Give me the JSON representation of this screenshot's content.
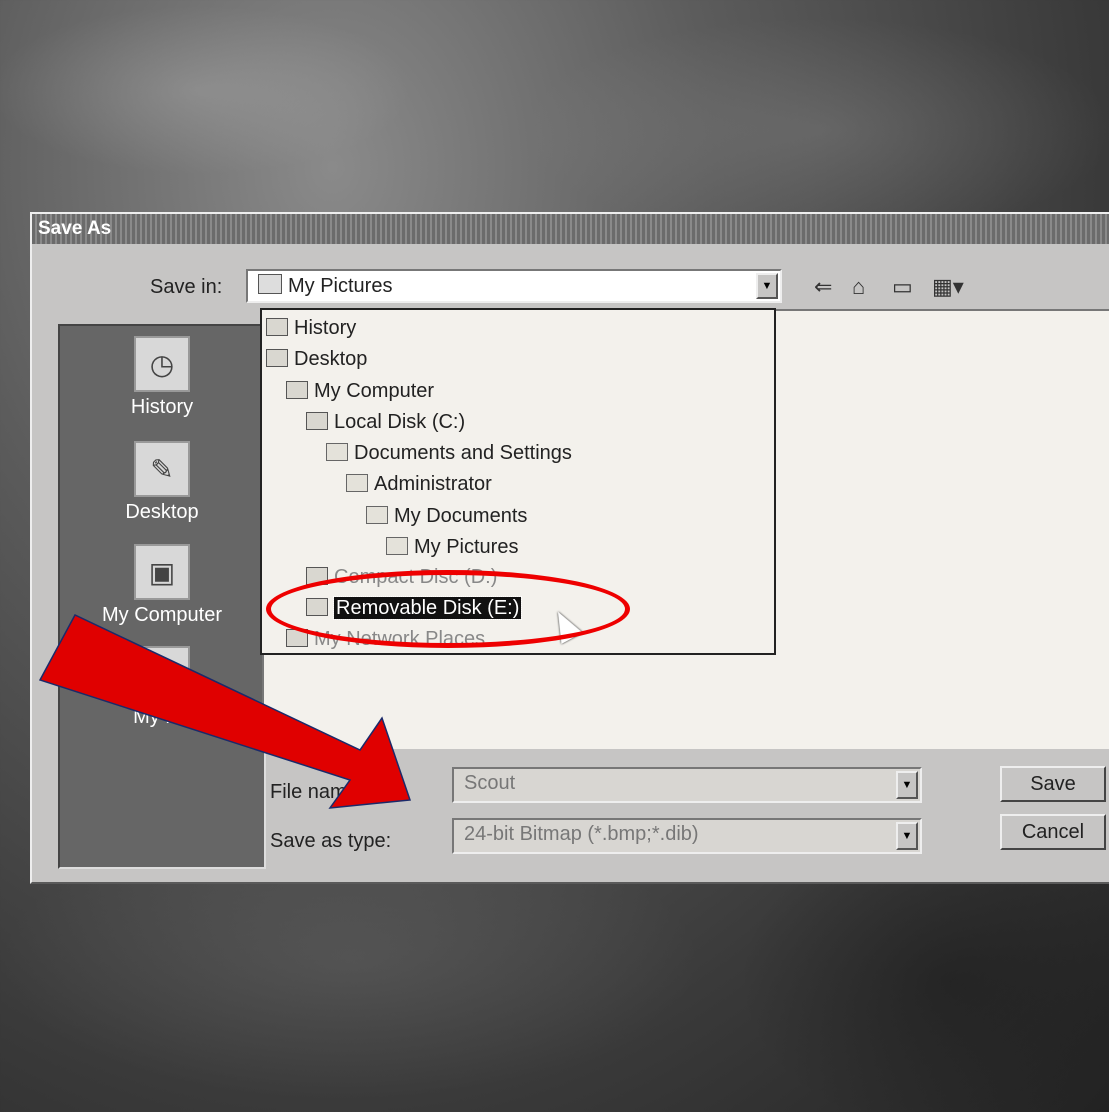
{
  "dialog": {
    "title": "Save As",
    "save_in_label": "Save in:",
    "save_in_value": "My Pictures"
  },
  "toolbar": {
    "icons": [
      "back-arrow-icon",
      "up-folder-icon",
      "new-folder-icon",
      "view-menu-icon"
    ]
  },
  "places": [
    {
      "label": "History",
      "icon": "history-icon"
    },
    {
      "label": "Desktop",
      "icon": "desktop-icon"
    },
    {
      "label": "My Computer",
      "icon": "my-computer-icon"
    },
    {
      "label": "My Ne",
      "icon": "network-places-icon"
    }
  ],
  "dropdown": {
    "items": [
      {
        "label": "History",
        "indent": 0
      },
      {
        "label": "Desktop",
        "indent": 0
      },
      {
        "label": "My Computer",
        "indent": 1
      },
      {
        "label": "Local Disk (C:)",
        "indent": 2
      },
      {
        "label": "Documents and Settings",
        "indent": 3
      },
      {
        "label": "Administrator",
        "indent": 4
      },
      {
        "label": "My Documents",
        "indent": 5
      },
      {
        "label": "My Pictures",
        "indent": 6
      },
      {
        "label": "Compact Disc (D:)",
        "indent": 2
      },
      {
        "label": "Removable Disk (E:)",
        "indent": 2,
        "selected": true
      },
      {
        "label": "My Network Places",
        "indent": 1
      }
    ]
  },
  "file_name": {
    "label": "File name:",
    "value": "Scout"
  },
  "save_as_type": {
    "label": "Save as type:",
    "value": "24-bit Bitmap (*.bmp;*.dib)"
  },
  "buttons": {
    "save": "Save",
    "cancel": "Cancel"
  },
  "annotation": {
    "highlight_color": "#e00000"
  }
}
